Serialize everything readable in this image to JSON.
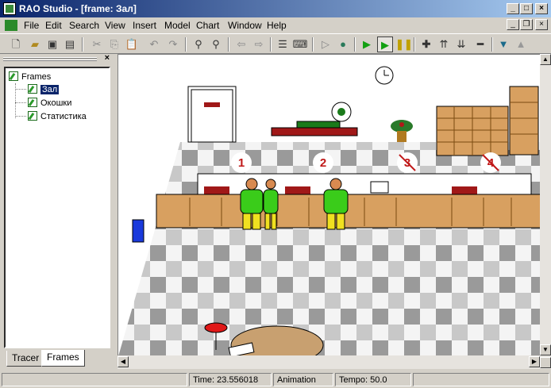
{
  "window": {
    "title": "RAO Studio - [frame: Зал]"
  },
  "menu": [
    "File",
    "Edit",
    "Search",
    "View",
    "Insert",
    "Model",
    "Chart",
    "Window",
    "Help"
  ],
  "tree": {
    "root": "Frames",
    "items": [
      "Зал",
      "Окошки",
      "Статистика"
    ],
    "selected": "Зал"
  },
  "tabs": [
    "Tracer",
    "Frames"
  ],
  "scene": {
    "counters": [
      "1",
      "2",
      "3",
      "4"
    ]
  },
  "status": {
    "time": "Time: 23.556018",
    "mode": "Animation",
    "tempo": "Tempo: 50.0"
  }
}
